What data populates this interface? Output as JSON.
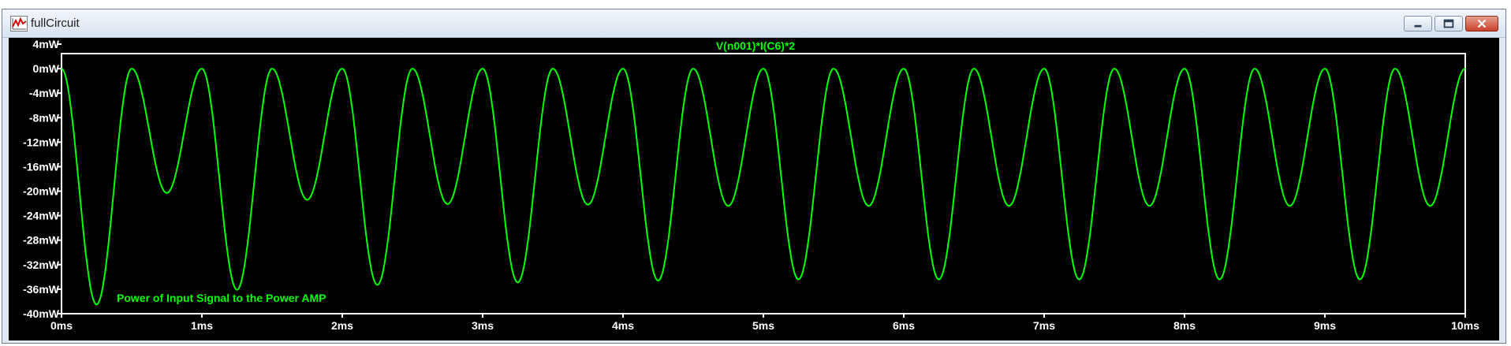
{
  "window": {
    "title": "fullCircuit",
    "icon": "waveform-icon",
    "buttons": [
      "minimize-icon",
      "maximize-icon",
      "close-icon"
    ]
  },
  "chart_data": {
    "type": "line",
    "title": "V(n001)*I(C6)*2",
    "annotation": "Power of Input Signal to the Power AMP",
    "xlabel": "",
    "ylabel": "",
    "x_unit": "ms",
    "y_unit": "mW",
    "xlim": [
      0,
      10
    ],
    "ylim": [
      -40,
      4
    ],
    "x_ticks": [
      0,
      1,
      2,
      3,
      4,
      5,
      6,
      7,
      8,
      9,
      10
    ],
    "y_ticks": [
      4,
      0,
      -4,
      -8,
      -12,
      -16,
      -20,
      -24,
      -28,
      -32,
      -36,
      -40
    ],
    "x_tick_labels": [
      "0ms",
      "1ms",
      "2ms",
      "3ms",
      "4ms",
      "5ms",
      "6ms",
      "7ms",
      "8ms",
      "9ms",
      "10ms"
    ],
    "y_tick_labels": [
      "4mW",
      "0mW",
      "-4mW",
      "-8mW",
      "-12mW",
      "-16mW",
      "-20mW",
      "-24mW",
      "-28mW",
      "-32mW",
      "-36mW",
      "-40mW"
    ],
    "grid": false,
    "background": "#000000",
    "series": [
      {
        "color": "#00ff00",
        "x": [
          0,
          0.25,
          0.5,
          0.75,
          1.0,
          1.25,
          1.5,
          1.75,
          2.0,
          2.25,
          2.5,
          2.75,
          3.0,
          3.25,
          3.5,
          3.75,
          4.0,
          4.25,
          4.5,
          4.75,
          5.0,
          5.25,
          5.5,
          5.75,
          6.0,
          6.25,
          6.5,
          6.75,
          7.0,
          7.25,
          7.5,
          7.75,
          8.0,
          8.25,
          8.5,
          8.75,
          9.0,
          9.25,
          9.5,
          9.75,
          10.0
        ],
        "values": [
          0,
          -38.5,
          0,
          -20.3,
          0,
          -36.1,
          0,
          -21.4,
          0,
          -35.3,
          0,
          -22.1,
          0,
          -34.9,
          0,
          -22.2,
          0,
          -34.6,
          0,
          -22.4,
          0,
          -34.4,
          0,
          -22.4,
          0,
          -34.4,
          0,
          -22.4,
          0,
          -34.4,
          0,
          -22.4,
          0,
          -34.4,
          0,
          -22.4,
          0,
          -34.4,
          0,
          -22.4,
          0
        ]
      }
    ]
  }
}
